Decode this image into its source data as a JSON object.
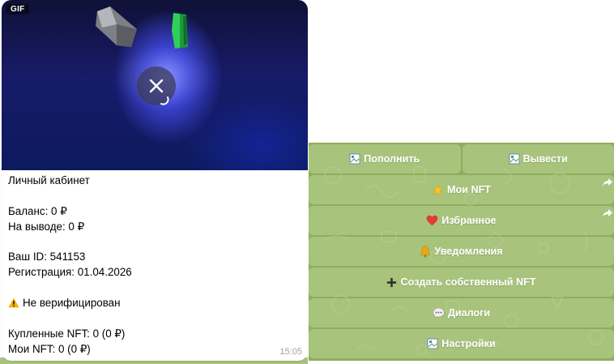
{
  "message": {
    "media_badge": "GIF",
    "title": "Личный кабинет",
    "balance_label": "Баланс:",
    "balance_value": "0 ₽",
    "withdraw_label": "На выводе:",
    "withdraw_value": "0 ₽",
    "user_id": "Ваш ID: 541153",
    "registration": "Регистрация: 01.04.2026",
    "verification_status": "Не верифицирован",
    "bought_nft_label": "Купленные NFT:",
    "bought_nft_value": "0 (0 ₽)",
    "my_nft_label": "Мои NFT:",
    "my_nft_value": "0 (0 ₽)",
    "time": "15:05"
  },
  "keyboard": {
    "buttons": [
      {
        "label": "Пополнить",
        "icon": "broken-image-icon"
      },
      {
        "label": "Вывести",
        "icon": "broken-image-icon"
      },
      {
        "label": "Мои NFT",
        "icon": "star-icon"
      },
      {
        "label": "Избранное",
        "icon": "heart-icon"
      },
      {
        "label": "Уведомления",
        "icon": "bell-icon"
      },
      {
        "label": "Создать собственный NFT",
        "icon": "plus-icon"
      },
      {
        "label": "Диалоги",
        "icon": "speech-bubble-icon"
      },
      {
        "label": "Настройки",
        "icon": "broken-image-icon"
      }
    ]
  },
  "colors": {
    "keyboard_bg": "#8ead5e",
    "button_text": "#ffffff",
    "warning": "#f5b400",
    "heart": "#e53935"
  }
}
